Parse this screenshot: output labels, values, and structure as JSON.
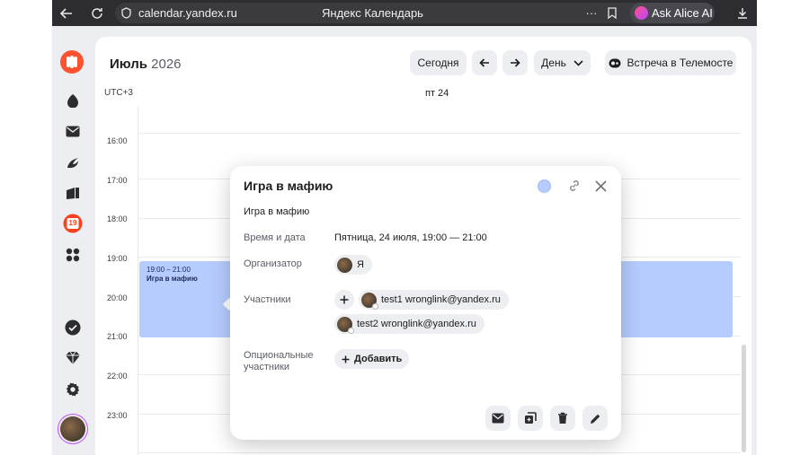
{
  "browser": {
    "url": "calendar.yandex.ru",
    "page_title": "Яндекс Календарь",
    "alice_label": "Ask Alice AI",
    "menu_dots": "···"
  },
  "sidebar": {
    "items": [
      {
        "name": "alice-icon"
      },
      {
        "name": "mail-icon"
      },
      {
        "name": "messenger-icon"
      },
      {
        "name": "disk-icon"
      },
      {
        "name": "calendar-icon",
        "badge": "19"
      },
      {
        "name": "services-icon"
      },
      {
        "name": "tasks-icon"
      },
      {
        "name": "plus-icon"
      },
      {
        "name": "settings-icon"
      }
    ]
  },
  "header": {
    "month": "Июль",
    "year": "2026",
    "today_label": "Сегодня",
    "view_label": "День",
    "telemost_label": "Встреча в Телемосте"
  },
  "grid": {
    "timezone": "UTC+3",
    "day_label": "пт 24",
    "hours": [
      "16:00",
      "17:00",
      "18:00",
      "19:00",
      "20:00",
      "21:00",
      "22:00",
      "23:00"
    ]
  },
  "event": {
    "time": "19:00 – 21:00",
    "title": "Игра в мафию"
  },
  "popup": {
    "title": "Игра в мафию",
    "description": "Игра в мафию",
    "datetime_label": "Время и дата",
    "datetime_value": "Пятница, 24 июля, 19:00 — 21:00",
    "organizer_label": "Организатор",
    "organizer_name": "Я",
    "participants_label": "Участники",
    "participants": [
      "test1 wronglink@yandex.ru",
      "test2 wronglink@yandex.ru"
    ],
    "optional_label_line1": "Опциональные",
    "optional_label_line2": "участники",
    "add_label": "Добавить",
    "colors": {
      "event": "#b6ccff"
    }
  }
}
